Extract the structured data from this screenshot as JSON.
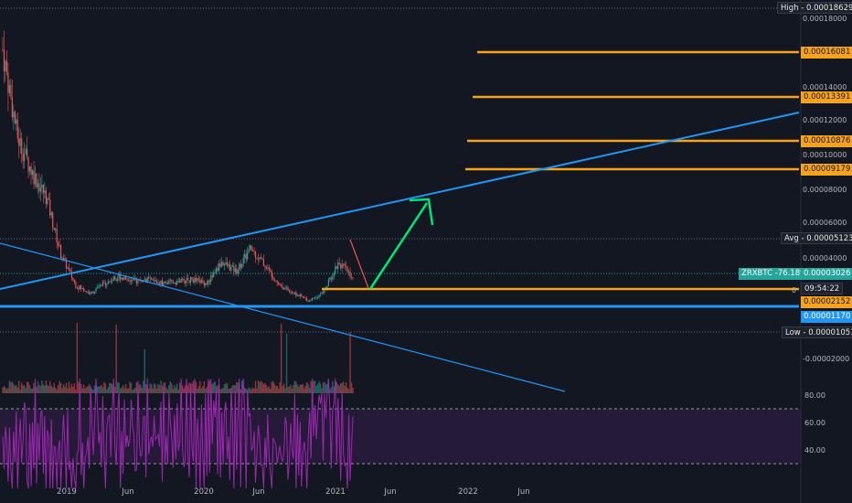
{
  "symbol": "ZRXBTC",
  "change_pct": "-76.18%",
  "price_label": "0.00003026",
  "countdown": "09:54:22",
  "high_tag": "High - 0.00018629",
  "avg_tag": "Avg - 0.00005123",
  "low_tag": "Low - 0.00001051",
  "level_tags": [
    "0.00016081",
    "0.00013391",
    "0.00010876",
    "0.00009179",
    "0.00002152"
  ],
  "blue_tag": "0.00001170",
  "zero_glyph": "0",
  "y_axis_labels": [
    "0.00018000",
    "0.00014000",
    "0.00012000",
    "0.00010000",
    "0.00008000",
    "0.00006000",
    "0.00004000",
    "-0.00002000"
  ],
  "x_axis_labels": [
    "2019",
    "Jun",
    "2020",
    "Jun",
    "2021",
    "Jun",
    "2022",
    "Jun"
  ],
  "rsi_axis_labels": [
    "80.00",
    "60.00",
    "40.00"
  ],
  "colors": {
    "background": "#131722",
    "up_candle": "#26a69a",
    "down_candle": "#ef5350",
    "trendline": "#2196f3",
    "levels": "#f7a21b",
    "arrow": "#00e676",
    "rsi": "#9c27b0"
  },
  "chart_data": {
    "type": "candlestick",
    "series": [
      {
        "name": "ZRXBTC"
      }
    ],
    "x_ticks": [
      "2019",
      "Jun",
      "2020",
      "Jun",
      "2021",
      "Jun",
      "2022",
      "Jun"
    ],
    "price": {
      "high": 0.00018629,
      "avg": 5.123e-05,
      "low": 1.051e-05,
      "last": 3.026e-05,
      "change_pct": -76.18,
      "close_path": [
        {
          "x": "2018-11",
          "y": 0.00016
        },
        {
          "x": "2018-12",
          "y": 0.00011
        },
        {
          "x": "2019-01",
          "y": 9e-05
        },
        {
          "x": "2019-03",
          "y": 7.5e-05
        },
        {
          "x": "2019-04",
          "y": 4.2e-05
        },
        {
          "x": "2019-05",
          "y": 2.5e-05
        },
        {
          "x": "2019-06",
          "y": 2e-05
        },
        {
          "x": "2019-07",
          "y": 2.6e-05
        },
        {
          "x": "2019-09",
          "y": 3e-05
        },
        {
          "x": "2019-10",
          "y": 2.7e-05
        },
        {
          "x": "2019-11",
          "y": 2.8e-05
        },
        {
          "x": "2019-12",
          "y": 2.6e-05
        },
        {
          "x": "2020-01",
          "y": 2.7e-05
        },
        {
          "x": "2020-02",
          "y": 2.8e-05
        },
        {
          "x": "2020-03",
          "y": 2.6e-05
        },
        {
          "x": "2020-05",
          "y": 3.8e-05
        },
        {
          "x": "2020-06",
          "y": 3.3e-05
        },
        {
          "x": "2020-08",
          "y": 4.6e-05
        },
        {
          "x": "2020-09",
          "y": 3.6e-05
        },
        {
          "x": "2020-10",
          "y": 2.5e-05
        },
        {
          "x": "2020-11",
          "y": 2e-05
        },
        {
          "x": "2020-12",
          "y": 1.6e-05
        },
        {
          "x": "2021-01",
          "y": 2.1e-05
        },
        {
          "x": "2021-02",
          "y": 3.8e-05
        },
        {
          "x": "2021-03",
          "y": 3e-05
        }
      ]
    },
    "horizontal_levels": [
      0.00016081,
      0.00013391,
      0.00010876,
      9.179e-05,
      2.152e-05,
      1.17e-05
    ],
    "rsi": {
      "upper": 70,
      "lower": 30
    }
  }
}
